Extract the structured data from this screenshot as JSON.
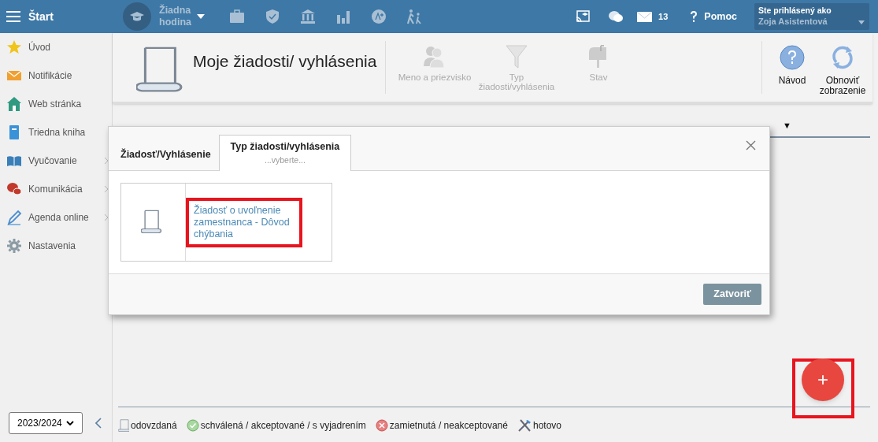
{
  "topbar": {
    "title": "Štart",
    "lesson": "Žiadna hodina",
    "mail_count": "13",
    "help": "Pomoc",
    "user_label": "Ste prihlásený ako",
    "user_name": "Zoja Asistentová"
  },
  "sidebar": {
    "items": [
      {
        "label": "Úvod",
        "kind": "star",
        "has_submenu": false
      },
      {
        "label": "Notifikácie",
        "kind": "mail",
        "has_submenu": false
      },
      {
        "label": "Web stránka",
        "kind": "house",
        "has_submenu": false
      },
      {
        "label": "Triedna kniha",
        "kind": "book",
        "has_submenu": false
      },
      {
        "label": "Vyučovanie",
        "kind": "openbook",
        "has_submenu": true
      },
      {
        "label": "Komunikácia",
        "kind": "chat",
        "has_submenu": true
      },
      {
        "label": "Agenda online",
        "kind": "pen",
        "has_submenu": true
      },
      {
        "label": "Nastavenia",
        "kind": "gear",
        "has_submenu": false
      }
    ],
    "year": "2023/2024"
  },
  "header": {
    "title": "Moje žiadosti/ vyhlásenia",
    "filters": [
      {
        "label": "Meno a priezvisko",
        "kind": "person"
      },
      {
        "label": "Typ žiadosti/vyhlásenia",
        "kind": "funnel"
      },
      {
        "label": "Stav",
        "kind": "mailbox"
      }
    ],
    "actions": [
      {
        "label": "Návod",
        "kind": "help"
      },
      {
        "label": "Obnoviť zobrazenie",
        "kind": "refresh"
      }
    ]
  },
  "sort_arrow": "▼",
  "dialog": {
    "tabs": [
      {
        "label": "Žiadosť/Vyhlásenie",
        "selected": false
      },
      {
        "label": "Typ žiadosti/vyhlásenia",
        "sublabel": "...vyberte...",
        "selected": true
      }
    ],
    "items": [
      {
        "label": "Žiadosť o uvoľnenie zamestnanca - Dôvod chýbania",
        "highlighted": true
      }
    ],
    "close_button": "Zatvoriť"
  },
  "legend": [
    {
      "label": "odovzdaná",
      "kind": "scroll"
    },
    {
      "label": "schválená / akceptované / s vyjadrením",
      "kind": "ok"
    },
    {
      "label": "zamietnutá / neakceptované",
      "kind": "rejected"
    },
    {
      "label": "hotovo",
      "kind": "tools"
    }
  ],
  "fab": {
    "label": "+",
    "highlighted": true
  }
}
